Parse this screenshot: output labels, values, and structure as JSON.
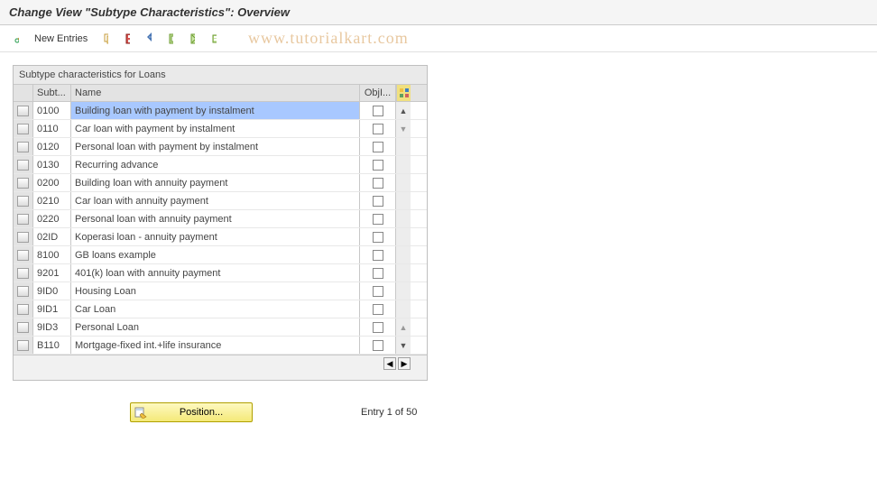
{
  "title": "Change View \"Subtype Characteristics\": Overview",
  "watermark": "www.tutorialkart.com",
  "toolbar": {
    "new_entries_label": "New Entries"
  },
  "grid": {
    "title": "Subtype characteristics for Loans",
    "columns": {
      "subt": "Subt...",
      "name": "Name",
      "obji": "ObjI..."
    },
    "rows": [
      {
        "subt": "0100",
        "name": "Building loan with payment by instalment",
        "highlight": true
      },
      {
        "subt": "0110",
        "name": "Car loan with payment by instalment"
      },
      {
        "subt": "0120",
        "name": "Personal loan with payment by instalment"
      },
      {
        "subt": "0130",
        "name": "Recurring advance"
      },
      {
        "subt": "0200",
        "name": "Building loan with annuity payment"
      },
      {
        "subt": "0210",
        "name": "Car loan with annuity payment"
      },
      {
        "subt": "0220",
        "name": "Personal loan with annuity payment"
      },
      {
        "subt": "02ID",
        "name": "Koperasi loan - annuity payment"
      },
      {
        "subt": "8100",
        "name": "GB loans example"
      },
      {
        "subt": "9201",
        "name": "401(k) loan with annuity payment"
      },
      {
        "subt": "9ID0",
        "name": "Housing Loan"
      },
      {
        "subt": "9ID1",
        "name": "Car Loan"
      },
      {
        "subt": "9ID3",
        "name": "Personal Loan"
      },
      {
        "subt": "B110",
        "name": "Mortgage-fixed int.+life insurance"
      }
    ]
  },
  "footer": {
    "position_label": "Position...",
    "entry_text": "Entry 1 of 50"
  }
}
